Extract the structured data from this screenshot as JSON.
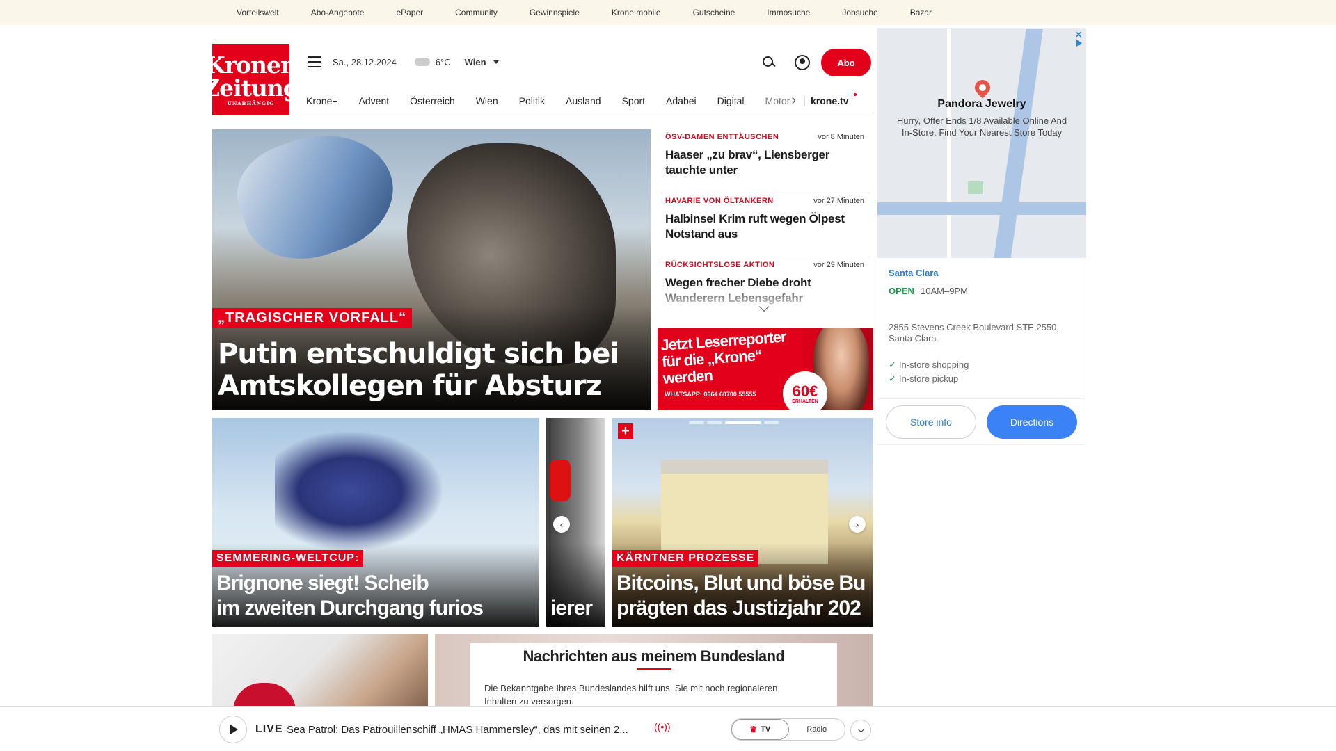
{
  "topbar": {
    "links": [
      "Vorteilswelt",
      "Abo-Angebote",
      "ePaper",
      "Community",
      "Gewinnspiele",
      "Krone mobile",
      "Gutscheine",
      "Immosuche",
      "Jobsuche",
      "Bazar"
    ]
  },
  "logo": {
    "line1": "Kronen",
    "line2": "Zeitung",
    "line3": "UNABHÄNGIG"
  },
  "header": {
    "date": "Sa., 28.12.2024",
    "weather_icon": "cloud-icon",
    "temperature": "6°C",
    "city": "Wien",
    "abo_label": "Abo"
  },
  "nav": {
    "items": [
      "Krone+",
      "Advent",
      "Österreich",
      "Wien",
      "Politik",
      "Ausland",
      "Sport",
      "Adabei",
      "Digital",
      "Motor"
    ],
    "extra": "krone.tv"
  },
  "hero": {
    "kicker": "„TRAGISCHER VORFALL“",
    "title": "Putin entschuldigt sich bei Amtskollegen für Absturz"
  },
  "news": [
    {
      "kicker": "ÖSV-DAMEN ENTTÄUSCHEN",
      "time": "vor 8 Minuten",
      "title": "Haaser „zu brav“, Liensberger tauchte unter"
    },
    {
      "kicker": "HAVARIE VON ÖLTANKERN",
      "time": "vor 27 Minuten",
      "title": "Halbinsel Krim ruft wegen Ölpest Notstand aus"
    },
    {
      "kicker": "RÜCKSICHTSLOSE AKTION",
      "time": "vor 29 Minuten",
      "title": "Wegen frecher Diebe droht Wanderern Lebensgefahr"
    }
  ],
  "promo": {
    "headline": "Jetzt Leserreporter für die „Krone“ werden",
    "whatsapp": "WHATSAPP: 0664 60700 55555",
    "badge_amount": "60€",
    "badge_label": "ERHALTEN"
  },
  "cards": [
    {
      "kicker": "SEMMERING-WELTCUP:",
      "title_line1": "Brignone siegt! Scheib",
      "title_line2": "im zweiten Durchgang furios"
    },
    {
      "kicker": "",
      "title_line1": "",
      "title_line2": "ierer"
    },
    {
      "kicker": "KÄRNTNER PROZESSE",
      "title_line1": "Bitcoins, Blut und böse Bu",
      "title_line2": "prägten das Justizjahr 202"
    }
  ],
  "bundesland": {
    "heading": "Nachrichten aus meinem Bundesland",
    "text": "Die Bekanntgabe Ihres Bundeslandes hilft uns, Sie mit noch regionaleren Inhalten zu versorgen."
  },
  "live": {
    "label": "LIVE",
    "text": "Sea Patrol: Das Patrouillenschiff „HMAS Hammersley“, das mit seinen 2...",
    "tv": "TV",
    "radio": "Radio"
  },
  "ad": {
    "store": "Pandora Jewelry",
    "description": "Hurry, Offer Ends 1/8 Available Online And In-Store. Find Your Nearest Store Today",
    "location": "Santa Clara",
    "open": "OPEN",
    "hours": "10AM–9PM",
    "address": "2855 Stevens Creek Boulevard STE 2550, Santa Clara",
    "features": [
      "In-store shopping",
      "In-store pickup"
    ],
    "btn_info": "Store info",
    "btn_directions": "Directions"
  },
  "colors": {
    "brand_red": "#e3001b",
    "topbar_bg": "#faf6e9",
    "link_blue": "#2a7ad4",
    "button_blue": "#3b82f6"
  }
}
